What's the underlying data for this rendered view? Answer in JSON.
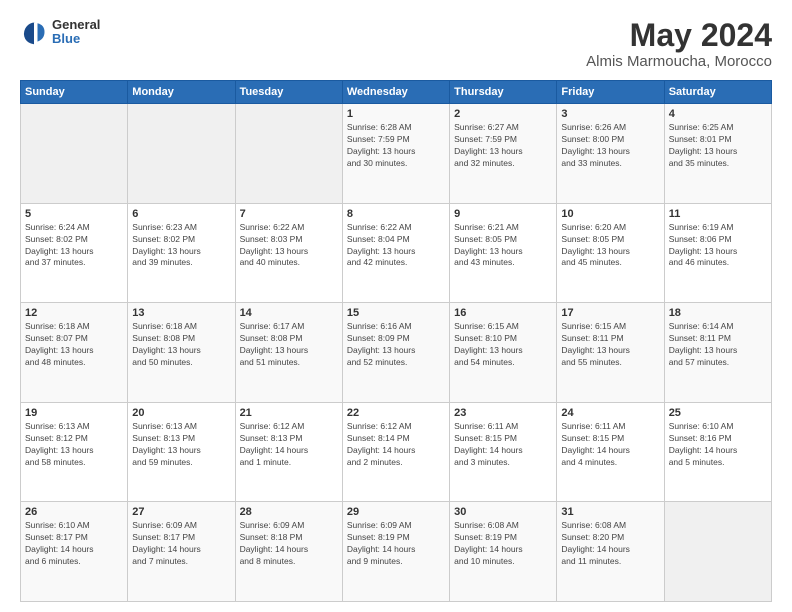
{
  "logo": {
    "general": "General",
    "blue": "Blue"
  },
  "title": "May 2024",
  "location": "Almis Marmoucha, Morocco",
  "days_header": [
    "Sunday",
    "Monday",
    "Tuesday",
    "Wednesday",
    "Thursday",
    "Friday",
    "Saturday"
  ],
  "weeks": [
    [
      {
        "day": "",
        "info": ""
      },
      {
        "day": "",
        "info": ""
      },
      {
        "day": "",
        "info": ""
      },
      {
        "day": "1",
        "info": "Sunrise: 6:28 AM\nSunset: 7:59 PM\nDaylight: 13 hours\nand 30 minutes."
      },
      {
        "day": "2",
        "info": "Sunrise: 6:27 AM\nSunset: 7:59 PM\nDaylight: 13 hours\nand 32 minutes."
      },
      {
        "day": "3",
        "info": "Sunrise: 6:26 AM\nSunset: 8:00 PM\nDaylight: 13 hours\nand 33 minutes."
      },
      {
        "day": "4",
        "info": "Sunrise: 6:25 AM\nSunset: 8:01 PM\nDaylight: 13 hours\nand 35 minutes."
      }
    ],
    [
      {
        "day": "5",
        "info": "Sunrise: 6:24 AM\nSunset: 8:02 PM\nDaylight: 13 hours\nand 37 minutes."
      },
      {
        "day": "6",
        "info": "Sunrise: 6:23 AM\nSunset: 8:02 PM\nDaylight: 13 hours\nand 39 minutes."
      },
      {
        "day": "7",
        "info": "Sunrise: 6:22 AM\nSunset: 8:03 PM\nDaylight: 13 hours\nand 40 minutes."
      },
      {
        "day": "8",
        "info": "Sunrise: 6:22 AM\nSunset: 8:04 PM\nDaylight: 13 hours\nand 42 minutes."
      },
      {
        "day": "9",
        "info": "Sunrise: 6:21 AM\nSunset: 8:05 PM\nDaylight: 13 hours\nand 43 minutes."
      },
      {
        "day": "10",
        "info": "Sunrise: 6:20 AM\nSunset: 8:05 PM\nDaylight: 13 hours\nand 45 minutes."
      },
      {
        "day": "11",
        "info": "Sunrise: 6:19 AM\nSunset: 8:06 PM\nDaylight: 13 hours\nand 46 minutes."
      }
    ],
    [
      {
        "day": "12",
        "info": "Sunrise: 6:18 AM\nSunset: 8:07 PM\nDaylight: 13 hours\nand 48 minutes."
      },
      {
        "day": "13",
        "info": "Sunrise: 6:18 AM\nSunset: 8:08 PM\nDaylight: 13 hours\nand 50 minutes."
      },
      {
        "day": "14",
        "info": "Sunrise: 6:17 AM\nSunset: 8:08 PM\nDaylight: 13 hours\nand 51 minutes."
      },
      {
        "day": "15",
        "info": "Sunrise: 6:16 AM\nSunset: 8:09 PM\nDaylight: 13 hours\nand 52 minutes."
      },
      {
        "day": "16",
        "info": "Sunrise: 6:15 AM\nSunset: 8:10 PM\nDaylight: 13 hours\nand 54 minutes."
      },
      {
        "day": "17",
        "info": "Sunrise: 6:15 AM\nSunset: 8:11 PM\nDaylight: 13 hours\nand 55 minutes."
      },
      {
        "day": "18",
        "info": "Sunrise: 6:14 AM\nSunset: 8:11 PM\nDaylight: 13 hours\nand 57 minutes."
      }
    ],
    [
      {
        "day": "19",
        "info": "Sunrise: 6:13 AM\nSunset: 8:12 PM\nDaylight: 13 hours\nand 58 minutes."
      },
      {
        "day": "20",
        "info": "Sunrise: 6:13 AM\nSunset: 8:13 PM\nDaylight: 13 hours\nand 59 minutes."
      },
      {
        "day": "21",
        "info": "Sunrise: 6:12 AM\nSunset: 8:13 PM\nDaylight: 14 hours\nand 1 minute."
      },
      {
        "day": "22",
        "info": "Sunrise: 6:12 AM\nSunset: 8:14 PM\nDaylight: 14 hours\nand 2 minutes."
      },
      {
        "day": "23",
        "info": "Sunrise: 6:11 AM\nSunset: 8:15 PM\nDaylight: 14 hours\nand 3 minutes."
      },
      {
        "day": "24",
        "info": "Sunrise: 6:11 AM\nSunset: 8:15 PM\nDaylight: 14 hours\nand 4 minutes."
      },
      {
        "day": "25",
        "info": "Sunrise: 6:10 AM\nSunset: 8:16 PM\nDaylight: 14 hours\nand 5 minutes."
      }
    ],
    [
      {
        "day": "26",
        "info": "Sunrise: 6:10 AM\nSunset: 8:17 PM\nDaylight: 14 hours\nand 6 minutes."
      },
      {
        "day": "27",
        "info": "Sunrise: 6:09 AM\nSunset: 8:17 PM\nDaylight: 14 hours\nand 7 minutes."
      },
      {
        "day": "28",
        "info": "Sunrise: 6:09 AM\nSunset: 8:18 PM\nDaylight: 14 hours\nand 8 minutes."
      },
      {
        "day": "29",
        "info": "Sunrise: 6:09 AM\nSunset: 8:19 PM\nDaylight: 14 hours\nand 9 minutes."
      },
      {
        "day": "30",
        "info": "Sunrise: 6:08 AM\nSunset: 8:19 PM\nDaylight: 14 hours\nand 10 minutes."
      },
      {
        "day": "31",
        "info": "Sunrise: 6:08 AM\nSunset: 8:20 PM\nDaylight: 14 hours\nand 11 minutes."
      },
      {
        "day": "",
        "info": ""
      }
    ]
  ]
}
